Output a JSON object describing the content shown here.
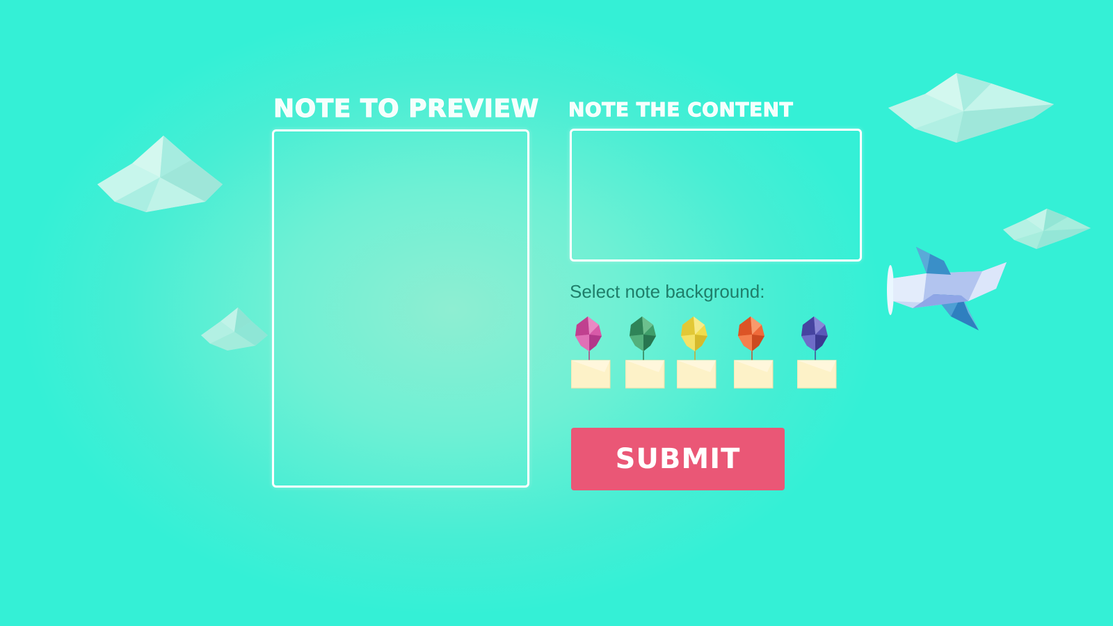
{
  "headings": {
    "preview": "Note to preview",
    "content": "Note the content"
  },
  "content_input": {
    "value": "",
    "placeholder": ""
  },
  "background_select": {
    "label": "Select note background:",
    "options": [
      {
        "name": "pink-balloon-icon",
        "color": "#d85aa8"
      },
      {
        "name": "green-balloon-icon",
        "color": "#3f9e6a"
      },
      {
        "name": "yellow-balloon-icon",
        "color": "#f1dc4c"
      },
      {
        "name": "orange-balloon-icon",
        "color": "#ef6a3a"
      },
      {
        "name": "purple-balloon-icon",
        "color": "#5a58b8"
      }
    ]
  },
  "submit": {
    "label": "Submit"
  },
  "colors": {
    "background": "#34f0d6",
    "accent": "#ea5776",
    "border": "#ffffff",
    "label_text": "#1f7e6a"
  }
}
